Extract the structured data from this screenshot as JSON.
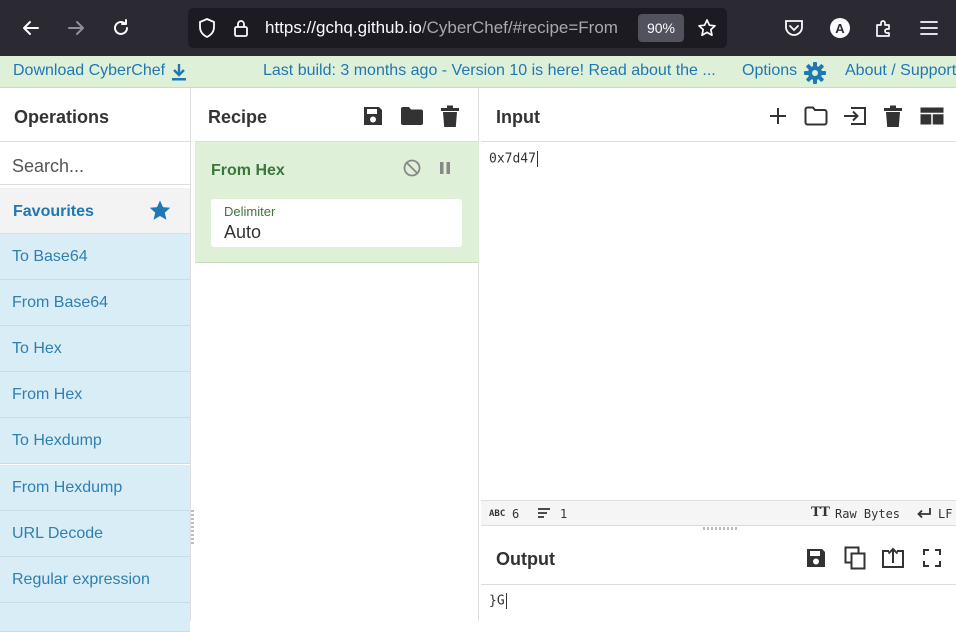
{
  "browser": {
    "url_host": "https://gchq.github.io",
    "url_path": "/CyberChef/#recipe=From",
    "zoom": "90%",
    "profile_initial": "A"
  },
  "banner": {
    "download": "Download CyberChef",
    "build": "Last build: 3 months ago - Version 10 is here! Read about the ...",
    "options": "Options",
    "about": "About / Support"
  },
  "operations": {
    "title": "Operations",
    "search_placeholder": "Search...",
    "favourites": "Favourites",
    "items": [
      "To Base64",
      "From Base64",
      "To Hex",
      "From Hex",
      "To Hexdump",
      "From Hexdump",
      "URL Decode",
      "Regular expression"
    ]
  },
  "recipe": {
    "title": "Recipe",
    "op_name": "From Hex",
    "arg_label": "Delimiter",
    "arg_value": "Auto"
  },
  "input": {
    "title": "Input",
    "text": "0x7d47",
    "stat_chars": "6",
    "stat_lines": "1",
    "encoding": "Raw Bytes",
    "eol": "LF"
  },
  "output": {
    "title": "Output",
    "text": "}G"
  },
  "colors": {
    "accent_blue": "#1f77b4",
    "banner_green": "#dff0d8",
    "op_blue": "#d9edf7",
    "op_green_text": "#3c763d"
  }
}
